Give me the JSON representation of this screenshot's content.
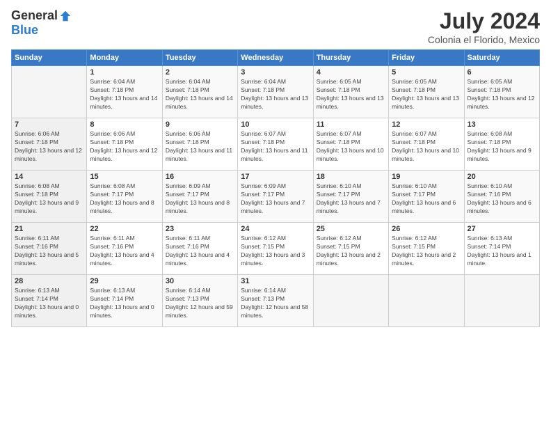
{
  "logo": {
    "general": "General",
    "blue": "Blue"
  },
  "header": {
    "title": "July 2024",
    "subtitle": "Colonia el Florido, Mexico"
  },
  "weekdays": [
    "Sunday",
    "Monday",
    "Tuesday",
    "Wednesday",
    "Thursday",
    "Friday",
    "Saturday"
  ],
  "weeks": [
    [
      {
        "day": "",
        "sunrise": "",
        "sunset": "",
        "daylight": ""
      },
      {
        "day": "1",
        "sunrise": "6:04 AM",
        "sunset": "7:18 PM",
        "daylight": "13 hours and 14 minutes."
      },
      {
        "day": "2",
        "sunrise": "6:04 AM",
        "sunset": "7:18 PM",
        "daylight": "13 hours and 14 minutes."
      },
      {
        "day": "3",
        "sunrise": "6:04 AM",
        "sunset": "7:18 PM",
        "daylight": "13 hours and 13 minutes."
      },
      {
        "day": "4",
        "sunrise": "6:05 AM",
        "sunset": "7:18 PM",
        "daylight": "13 hours and 13 minutes."
      },
      {
        "day": "5",
        "sunrise": "6:05 AM",
        "sunset": "7:18 PM",
        "daylight": "13 hours and 13 minutes."
      },
      {
        "day": "6",
        "sunrise": "6:05 AM",
        "sunset": "7:18 PM",
        "daylight": "13 hours and 12 minutes."
      }
    ],
    [
      {
        "day": "7",
        "sunrise": "6:06 AM",
        "sunset": "7:18 PM",
        "daylight": "13 hours and 12 minutes."
      },
      {
        "day": "8",
        "sunrise": "6:06 AM",
        "sunset": "7:18 PM",
        "daylight": "13 hours and 12 minutes."
      },
      {
        "day": "9",
        "sunrise": "6:06 AM",
        "sunset": "7:18 PM",
        "daylight": "13 hours and 11 minutes."
      },
      {
        "day": "10",
        "sunrise": "6:07 AM",
        "sunset": "7:18 PM",
        "daylight": "13 hours and 11 minutes."
      },
      {
        "day": "11",
        "sunrise": "6:07 AM",
        "sunset": "7:18 PM",
        "daylight": "13 hours and 10 minutes."
      },
      {
        "day": "12",
        "sunrise": "6:07 AM",
        "sunset": "7:18 PM",
        "daylight": "13 hours and 10 minutes."
      },
      {
        "day": "13",
        "sunrise": "6:08 AM",
        "sunset": "7:18 PM",
        "daylight": "13 hours and 9 minutes."
      }
    ],
    [
      {
        "day": "14",
        "sunrise": "6:08 AM",
        "sunset": "7:18 PM",
        "daylight": "13 hours and 9 minutes."
      },
      {
        "day": "15",
        "sunrise": "6:08 AM",
        "sunset": "7:17 PM",
        "daylight": "13 hours and 8 minutes."
      },
      {
        "day": "16",
        "sunrise": "6:09 AM",
        "sunset": "7:17 PM",
        "daylight": "13 hours and 8 minutes."
      },
      {
        "day": "17",
        "sunrise": "6:09 AM",
        "sunset": "7:17 PM",
        "daylight": "13 hours and 7 minutes."
      },
      {
        "day": "18",
        "sunrise": "6:10 AM",
        "sunset": "7:17 PM",
        "daylight": "13 hours and 7 minutes."
      },
      {
        "day": "19",
        "sunrise": "6:10 AM",
        "sunset": "7:17 PM",
        "daylight": "13 hours and 6 minutes."
      },
      {
        "day": "20",
        "sunrise": "6:10 AM",
        "sunset": "7:16 PM",
        "daylight": "13 hours and 6 minutes."
      }
    ],
    [
      {
        "day": "21",
        "sunrise": "6:11 AM",
        "sunset": "7:16 PM",
        "daylight": "13 hours and 5 minutes."
      },
      {
        "day": "22",
        "sunrise": "6:11 AM",
        "sunset": "7:16 PM",
        "daylight": "13 hours and 4 minutes."
      },
      {
        "day": "23",
        "sunrise": "6:11 AM",
        "sunset": "7:16 PM",
        "daylight": "13 hours and 4 minutes."
      },
      {
        "day": "24",
        "sunrise": "6:12 AM",
        "sunset": "7:15 PM",
        "daylight": "13 hours and 3 minutes."
      },
      {
        "day": "25",
        "sunrise": "6:12 AM",
        "sunset": "7:15 PM",
        "daylight": "13 hours and 2 minutes."
      },
      {
        "day": "26",
        "sunrise": "6:12 AM",
        "sunset": "7:15 PM",
        "daylight": "13 hours and 2 minutes."
      },
      {
        "day": "27",
        "sunrise": "6:13 AM",
        "sunset": "7:14 PM",
        "daylight": "13 hours and 1 minute."
      }
    ],
    [
      {
        "day": "28",
        "sunrise": "6:13 AM",
        "sunset": "7:14 PM",
        "daylight": "13 hours and 0 minutes."
      },
      {
        "day": "29",
        "sunrise": "6:13 AM",
        "sunset": "7:14 PM",
        "daylight": "13 hours and 0 minutes."
      },
      {
        "day": "30",
        "sunrise": "6:14 AM",
        "sunset": "7:13 PM",
        "daylight": "12 hours and 59 minutes."
      },
      {
        "day": "31",
        "sunrise": "6:14 AM",
        "sunset": "7:13 PM",
        "daylight": "12 hours and 58 minutes."
      },
      {
        "day": "",
        "sunrise": "",
        "sunset": "",
        "daylight": ""
      },
      {
        "day": "",
        "sunrise": "",
        "sunset": "",
        "daylight": ""
      },
      {
        "day": "",
        "sunrise": "",
        "sunset": "",
        "daylight": ""
      }
    ]
  ],
  "labels": {
    "sunrise_prefix": "Sunrise: ",
    "sunset_prefix": "Sunset: ",
    "daylight_prefix": "Daylight: "
  }
}
